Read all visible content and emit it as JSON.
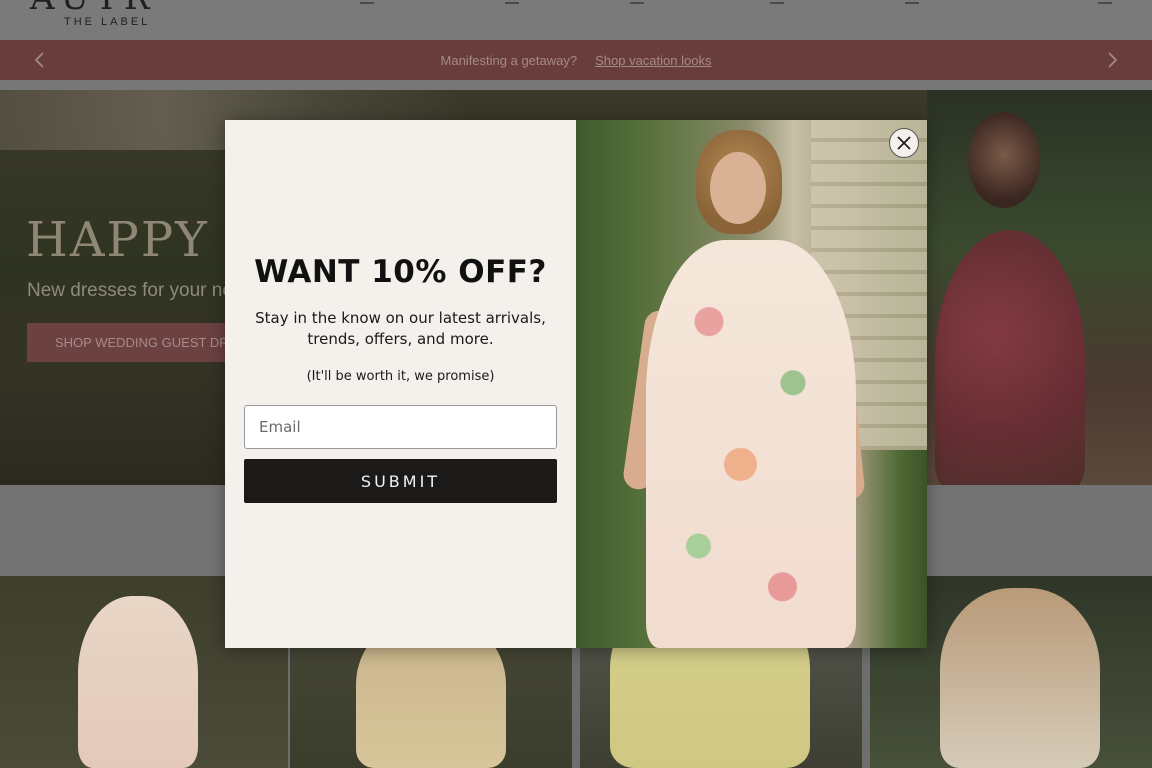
{
  "header": {
    "logo_text": "AUTR",
    "logo_subtext": "THE LABEL"
  },
  "promo_bar": {
    "message": "Manifesting a getaway?",
    "link_label": "Shop vacation looks",
    "prev_icon": "chevron-left-icon",
    "next_icon": "chevron-right-icon"
  },
  "hero": {
    "title": "HAPPY F",
    "subtitle": "New dresses for your ne",
    "cta_label": "SHOP WEDDING GUEST DRE"
  },
  "popup": {
    "headline": "WANT 10% OFF?",
    "body": "Stay in the know on our latest arrivals, trends, offers, and more.",
    "note": "(It'll be worth it, we promise)",
    "email_placeholder": "Email",
    "email_value": "",
    "submit_label": "SUBMIT",
    "close_icon": "close-icon"
  },
  "colors": {
    "promo_bg": "#6a3d3d",
    "popup_bg": "#f4f1ec",
    "submit_bg": "#1c1a19",
    "overlay": "#6e6e6e"
  }
}
